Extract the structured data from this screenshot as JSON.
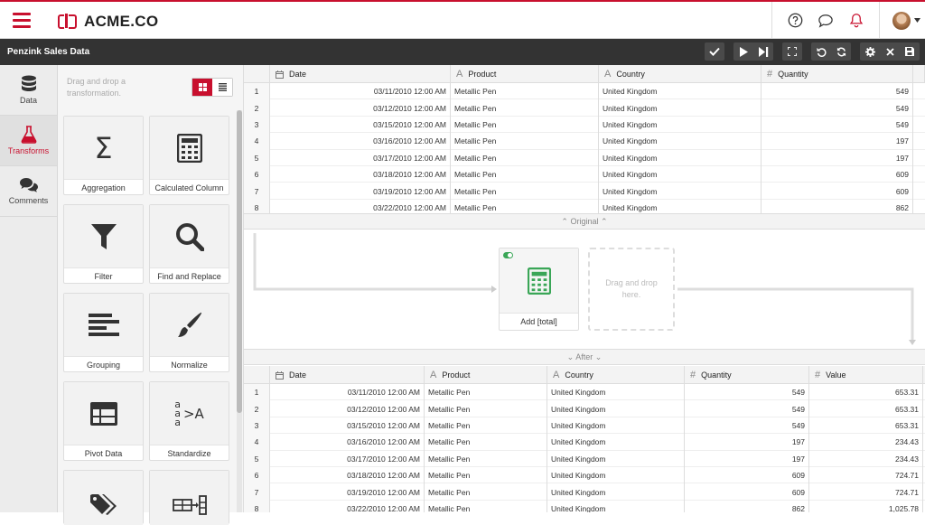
{
  "app": {
    "brand": "ACME.CO",
    "dataset_title": "Penzink Sales Data"
  },
  "icons": {
    "menu": "hamburger-icon",
    "help": "help-icon",
    "chat": "chat-icon",
    "bell": "bell-icon"
  },
  "colors": {
    "accent": "#c8102e",
    "toolbar": "#333333",
    "toggle_on": "#3aa657"
  },
  "nav": {
    "items": [
      {
        "label": "Data",
        "icon": "database-icon"
      },
      {
        "label": "Transforms",
        "icon": "flask-icon"
      },
      {
        "label": "Comments",
        "icon": "comments-icon"
      }
    ],
    "active": "Transforms"
  },
  "palette": {
    "hint": "Drag and drop a transformation.",
    "cards": [
      "Aggregation",
      "Calculated Column",
      "Filter",
      "Find and Replace",
      "Grouping",
      "Normalize",
      "Pivot Data",
      "Standardize",
      "",
      ""
    ]
  },
  "original": {
    "columns": [
      "Date",
      "Product",
      "Country",
      "Quantity"
    ],
    "rows": [
      [
        "1",
        "03/11/2010 12:00 AM",
        "Metallic Pen",
        "United Kingdom",
        "549"
      ],
      [
        "2",
        "03/12/2010 12:00 AM",
        "Metallic Pen",
        "United Kingdom",
        "549"
      ],
      [
        "3",
        "03/15/2010 12:00 AM",
        "Metallic Pen",
        "United Kingdom",
        "549"
      ],
      [
        "4",
        "03/16/2010 12:00 AM",
        "Metallic Pen",
        "United Kingdom",
        "197"
      ],
      [
        "5",
        "03/17/2010 12:00 AM",
        "Metallic Pen",
        "United Kingdom",
        "197"
      ],
      [
        "6",
        "03/18/2010 12:00 AM",
        "Metallic Pen",
        "United Kingdom",
        "609"
      ],
      [
        "7",
        "03/19/2010 12:00 AM",
        "Metallic Pen",
        "United Kingdom",
        "609"
      ],
      [
        "8",
        "03/22/2010 12:00 AM",
        "Metallic Pen",
        "United Kingdom",
        "862"
      ]
    ],
    "label": "Original"
  },
  "flow": {
    "step_label": "Add [total]",
    "drop_hint": "Drag and drop here."
  },
  "after": {
    "columns": [
      "Date",
      "Product",
      "Country",
      "Quantity",
      "Value"
    ],
    "rows": [
      [
        "1",
        "03/11/2010 12:00 AM",
        "Metallic Pen",
        "United Kingdom",
        "549",
        "653.31"
      ],
      [
        "2",
        "03/12/2010 12:00 AM",
        "Metallic Pen",
        "United Kingdom",
        "549",
        "653.31"
      ],
      [
        "3",
        "03/15/2010 12:00 AM",
        "Metallic Pen",
        "United Kingdom",
        "549",
        "653.31"
      ],
      [
        "4",
        "03/16/2010 12:00 AM",
        "Metallic Pen",
        "United Kingdom",
        "197",
        "234.43"
      ],
      [
        "5",
        "03/17/2010 12:00 AM",
        "Metallic Pen",
        "United Kingdom",
        "197",
        "234.43"
      ],
      [
        "6",
        "03/18/2010 12:00 AM",
        "Metallic Pen",
        "United Kingdom",
        "609",
        "724.71"
      ],
      [
        "7",
        "03/19/2010 12:00 AM",
        "Metallic Pen",
        "United Kingdom",
        "609",
        "724.71"
      ],
      [
        "8",
        "03/22/2010 12:00 AM",
        "Metallic Pen",
        "United Kingdom",
        "862",
        "1,025.78"
      ]
    ],
    "label": "After"
  }
}
